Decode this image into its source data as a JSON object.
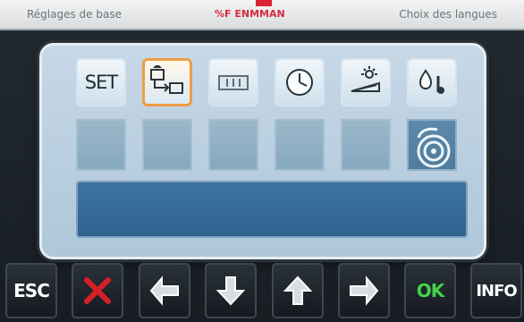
{
  "tabs": {
    "left": "Réglages de base",
    "center": "%F ENMMAN",
    "right": "Choix des langues"
  },
  "icons": {
    "top": [
      {
        "label": "SET",
        "icon": "set-text-icon",
        "selected": false
      },
      {
        "label": "",
        "icon": "program-transfer-icon",
        "selected": true
      },
      {
        "label": "",
        "icon": "data-module-icon",
        "selected": false
      },
      {
        "label": "",
        "icon": "clock-icon",
        "selected": false
      },
      {
        "label": "",
        "icon": "ramp-temperature-icon",
        "selected": false
      },
      {
        "label": "",
        "icon": "water-drop-icon",
        "selected": false
      }
    ],
    "second": [
      {
        "icon": "empty-slot",
        "filled": false
      },
      {
        "icon": "empty-slot",
        "filled": false
      },
      {
        "icon": "empty-slot",
        "filled": false
      },
      {
        "icon": "empty-slot",
        "filled": false
      },
      {
        "icon": "empty-slot",
        "filled": false
      },
      {
        "icon": "wash-drum-icon",
        "filled": true
      }
    ]
  },
  "footer": {
    "esc": "ESC",
    "ok": "OK",
    "info": "INFO"
  },
  "colors": {
    "active_tab": "#d62b3f",
    "selected_border": "#ef9d46",
    "cancel": "#d71f26",
    "ok": "#43d14b"
  }
}
